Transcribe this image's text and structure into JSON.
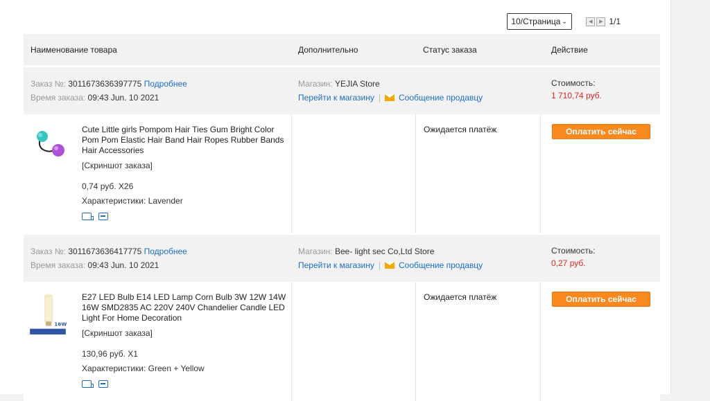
{
  "pager": {
    "per_page": "10/Страница",
    "page": "1/1"
  },
  "table_headers": {
    "product": "Наименование товара",
    "additional": "Дополнительно",
    "status": "Статус заказа",
    "action": "Действие"
  },
  "orders": [
    {
      "order_label": "Заказ №:",
      "order_number": "3011673636397775",
      "details_link": "Подробнее",
      "time_label": "Время заказа:",
      "time": "09:43 Jun. 10 2021",
      "store_label": "Магазин:",
      "store_name": "YEJIA Store",
      "go_store": "Перейти к магазину",
      "separator": "|",
      "message_seller": "Сообщение продавцу",
      "cost_label": "Стоимость:",
      "cost": "1 710,74 руб.",
      "product_name": "Cute Little girls Pompom Hair Ties Gum Bright Color Pom Pom Elastic Hair Band Hair Ropes Rubber Bands Hair Accessories",
      "screenshot": "[Скриншот заказа]",
      "unit_price": "0,74 руб. X26",
      "specs_label": "Характеристики:",
      "specs": "Lavender",
      "status": "Ожидается платёж",
      "pay_button": "Оплатить сейчас"
    },
    {
      "order_label": "Заказ №:",
      "order_number": "3011673636417775",
      "details_link": "Подробнее",
      "time_label": "Время заказа:",
      "time": "09:43 Jun. 10 2021",
      "store_label": "Магазин:",
      "store_name": "Bee- light sec Co,Ltd Store",
      "go_store": "Перейти к магазину",
      "separator": "|",
      "message_seller": "Сообщение продавцу",
      "cost_label": "Стоимость:",
      "cost": "0,27 руб.",
      "product_name": "E27 LED Bulb E14 LED Lamp Corn Bulb 3W 12W 14W 16W SMD2835 AC 220V 240V Chandelier Candle LED Light For Home Decoration",
      "screenshot": "[Скриншот заказа]",
      "unit_price": "130,96 руб. X1",
      "specs_label": "Характеристики:",
      "specs": "Green + Yellow",
      "status": "Ожидается платёж",
      "pay_button": "Оплатить сейчас",
      "thumb_badge": "16W"
    }
  ],
  "colors": {
    "link": "#1a6ec9",
    "price": "#e0281d",
    "pay_button": "#f7891e",
    "header_bg": "#f2f2f2"
  }
}
